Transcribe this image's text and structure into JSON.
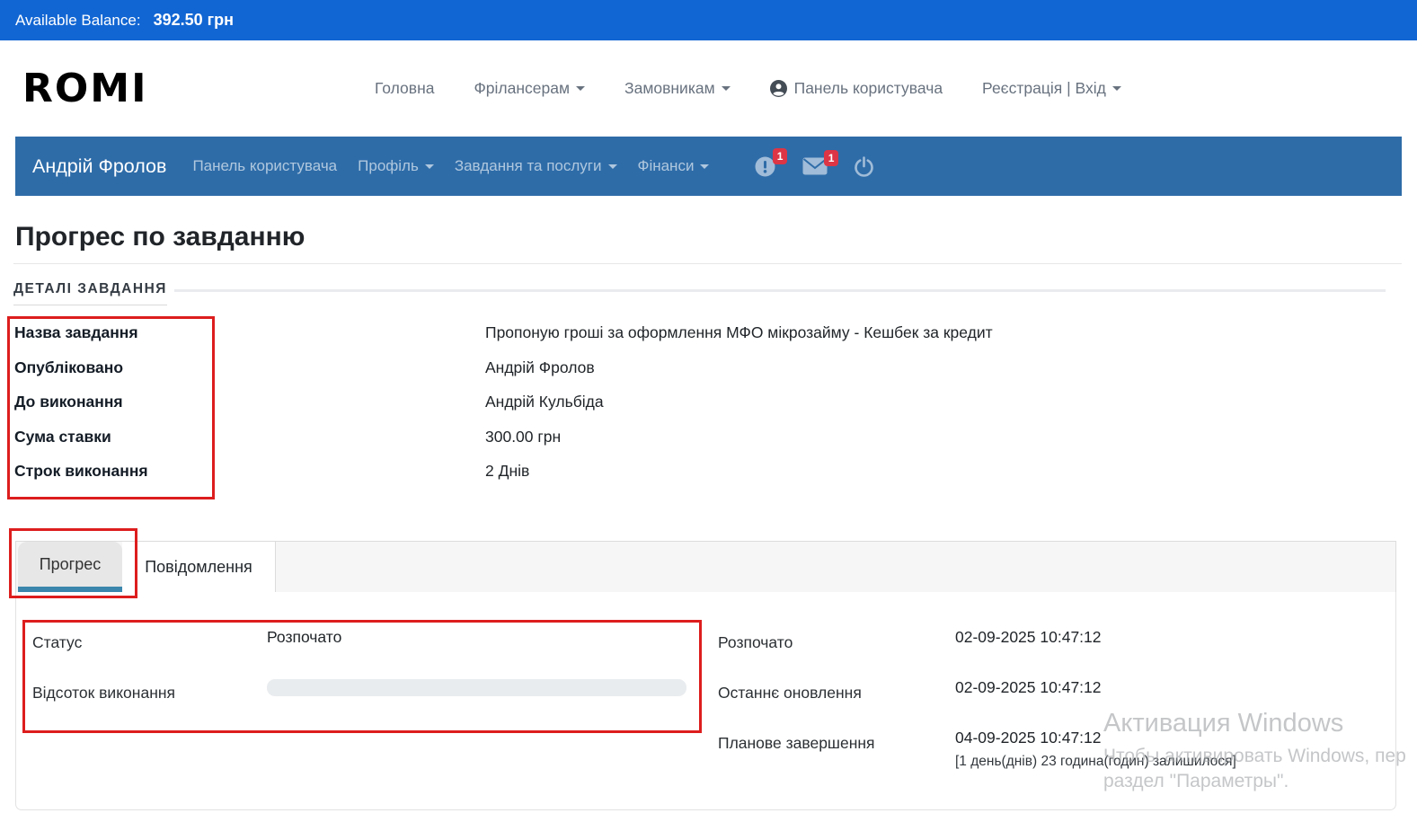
{
  "topbar": {
    "label": "Available Balance:",
    "value": "392.50 грн"
  },
  "header": {
    "logo": "ROMI",
    "nav": [
      {
        "label": "Головна"
      },
      {
        "label": "Фрілансерам"
      },
      {
        "label": "Замовникам"
      },
      {
        "label": "Панель користувача"
      },
      {
        "label": "Реєстрація | Вхід"
      }
    ]
  },
  "user_navbar": {
    "brand": "Андрій Фролов",
    "links": [
      {
        "label": "Панель користувача"
      },
      {
        "label": "Профіль"
      },
      {
        "label": "Завдання та послуги"
      },
      {
        "label": "Фінанси"
      }
    ],
    "alerts_badge": "1",
    "messages_badge": "1"
  },
  "page": {
    "title": "Прогрес по завданню",
    "section_heading": "ДЕТАЛІ ЗАВДАННЯ"
  },
  "details": {
    "rows": [
      {
        "label": "Назва завдання",
        "value": "Пропоную гроші за оформлення МФО мікрозайму - Кешбек за кредит"
      },
      {
        "label": "Опубліковано",
        "value": "Андрій Фролов"
      },
      {
        "label": "До виконання",
        "value": "Андрій Кульбіда"
      },
      {
        "label": "Сума ставки",
        "value": "300.00 грн"
      },
      {
        "label": "Строк виконання",
        "value": "2 Днів"
      }
    ]
  },
  "tabs": [
    {
      "label": "Прогрес",
      "active": true
    },
    {
      "label": "Повідомлення",
      "active": false
    }
  ],
  "progress_panel": {
    "status_label": "Статус",
    "status_value": "Розпочато",
    "percent_label": "Відсоток виконання",
    "percent_complete": 0,
    "started_label": "Розпочато",
    "started_value": "02-09-2025 10:47:12",
    "updated_label": "Останнє оновлення",
    "updated_value": "02-09-2025 10:47:12",
    "due_label": "Планове завершення",
    "due_value": "04-09-2025 10:47:12",
    "remaining_value": "[1 день(днів) 23 година(годин) залишилося]"
  },
  "watermark": {
    "title": "Активация Windows",
    "line1": "Чтобы активировать Windows, пер",
    "line2": "раздел \"Параметры\"."
  },
  "colors": {
    "topbar_bg": "#1266d3",
    "navbar_bg": "#2e6ca8",
    "badge_red": "#dc3545",
    "tab_underline": "#3a86ad",
    "annotation_red": "#dd1d1d",
    "progress_track": "#e9ecef"
  }
}
